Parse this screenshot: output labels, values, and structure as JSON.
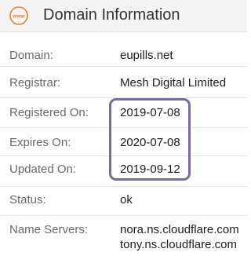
{
  "header": {
    "icon_text": "www",
    "title": "Domain Information"
  },
  "rows": [
    {
      "label": "Domain:",
      "value": "eupills.net"
    },
    {
      "label": "Registrar:",
      "value": "Mesh Digital Limited"
    },
    {
      "label": "Registered On:",
      "value": "2019-07-08"
    },
    {
      "label": "Expires On:",
      "value": "2020-07-08"
    },
    {
      "label": "Updated On:",
      "value": "2019-09-12"
    },
    {
      "label": "Status:",
      "value": "ok"
    },
    {
      "label": "Name Servers:",
      "values": [
        "nora.ns.cloudflare.com",
        "tony.ns.cloudflare.com"
      ]
    }
  ],
  "colors": {
    "icon_orange": "#f07c32",
    "highlight_purple": "#7b6a9c",
    "header_bg": "#f4f4f4"
  }
}
